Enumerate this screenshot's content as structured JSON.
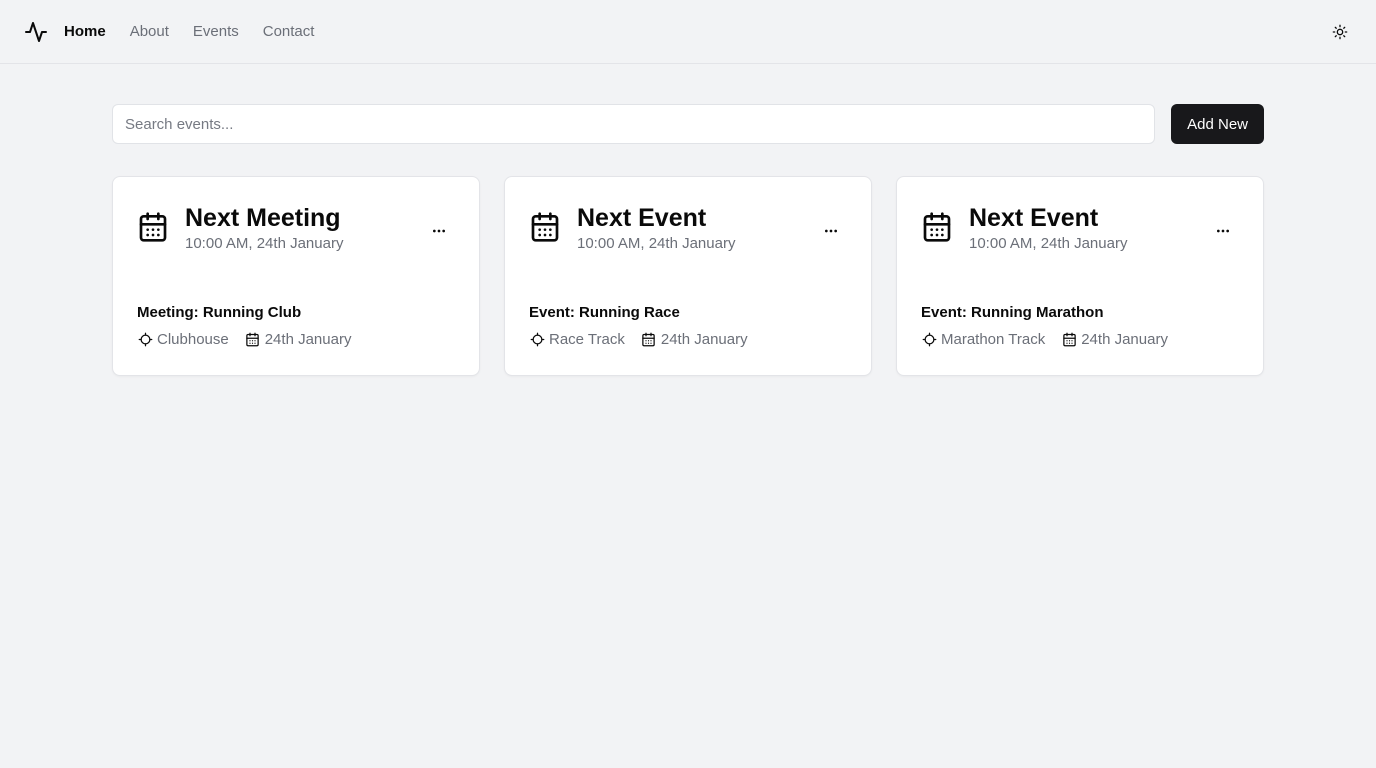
{
  "header": {
    "logo_icon": "activity-icon",
    "nav": [
      {
        "label": "Home",
        "active": true
      },
      {
        "label": "About",
        "active": false
      },
      {
        "label": "Events",
        "active": false
      },
      {
        "label": "Contact",
        "active": false
      }
    ],
    "theme_icon": "sun-icon"
  },
  "toolbar": {
    "search_placeholder": "Search events...",
    "add_label": "Add New"
  },
  "cards": [
    {
      "title": "Next Meeting",
      "subtitle": "10:00 AM, 24th January",
      "name": "Meeting: Running Club",
      "location": "Clubhouse",
      "date": "24th January"
    },
    {
      "title": "Next Event",
      "subtitle": "10:00 AM, 24th January",
      "name": "Event: Running Race",
      "location": "Race Track",
      "date": "24th January"
    },
    {
      "title": "Next Event",
      "subtitle": "10:00 AM, 24th January",
      "name": "Event: Running Marathon",
      "location": "Marathon Track",
      "date": "24th January"
    }
  ]
}
